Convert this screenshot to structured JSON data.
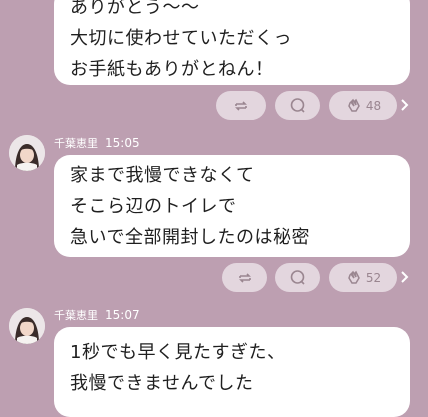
{
  "theme": {
    "background": "#bd9fb1",
    "bubble": "#ffffff",
    "action_pill": "#e3d6de"
  },
  "messages": [
    {
      "sender": "",
      "time": "",
      "lines": [
        "ありがとう〜〜",
        "大切に使わせていただくっ",
        "お手紙もありがとねん！"
      ],
      "reaction_count": "48"
    },
    {
      "sender": "千葉恵里",
      "time": "15:05",
      "lines": [
        "家まで我慢できなくて",
        "そこら辺のトイレで",
        "急いで全部開封したのは秘密"
      ],
      "reaction_count": "52"
    },
    {
      "sender": "千葉恵里",
      "time": "15:07",
      "lines": [
        "1秒でも早く見たすぎた、",
        "我慢できませんでした"
      ],
      "reaction_count": ""
    }
  ],
  "icons": {
    "share": "repost-icon",
    "comment": "comment-bubble-icon",
    "reaction": "clap-icon",
    "more": "chevron-right-icon"
  }
}
